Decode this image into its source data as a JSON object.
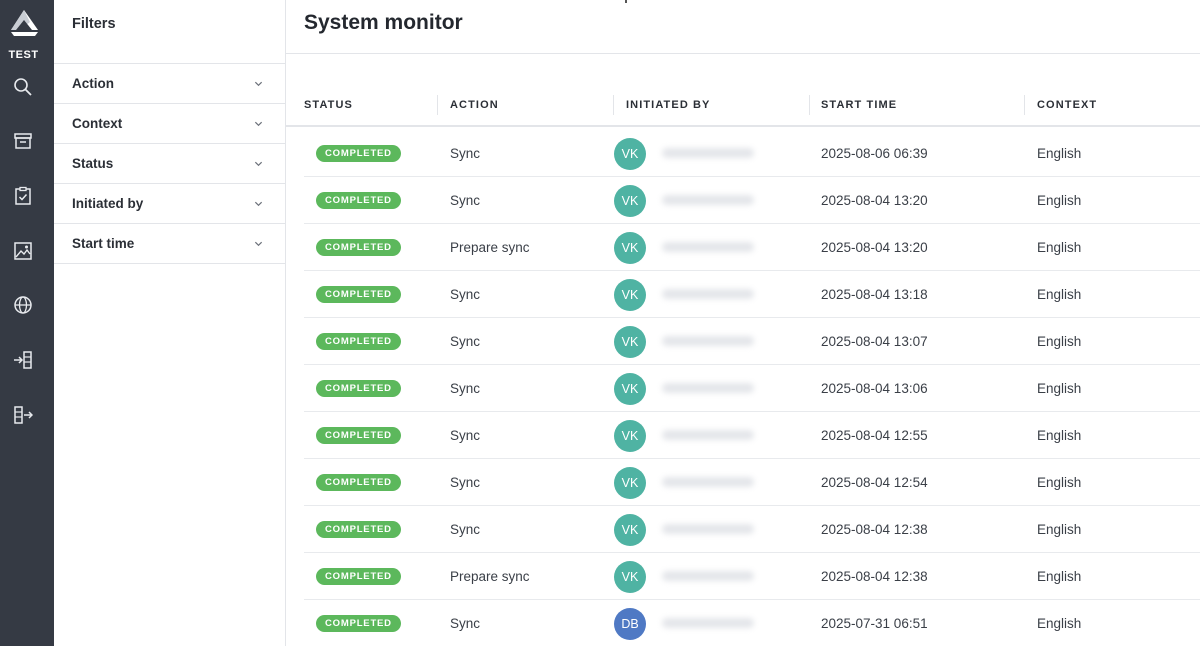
{
  "app": {
    "logo_text": "TEST"
  },
  "rail": {
    "icons": [
      "search-icon",
      "archive-icon",
      "clipboard-check-icon",
      "image-icon",
      "globe-icon",
      "import-icon",
      "export-icon"
    ]
  },
  "filters": {
    "title": "Filters",
    "items": [
      {
        "label": "Action"
      },
      {
        "label": "Context"
      },
      {
        "label": "Status"
      },
      {
        "label": "Initiated by"
      },
      {
        "label": "Start time"
      }
    ]
  },
  "main": {
    "title": "System monitor",
    "columns": [
      "STATUS",
      "ACTION",
      "INITIATED BY",
      "START TIME",
      "CONTEXT"
    ],
    "rows": [
      {
        "status": "COMPLETED",
        "action": "Sync",
        "initials": "VK",
        "start_time": "2025-08-06 06:39",
        "context": "English"
      },
      {
        "status": "COMPLETED",
        "action": "Sync",
        "initials": "VK",
        "start_time": "2025-08-04 13:20",
        "context": "English"
      },
      {
        "status": "COMPLETED",
        "action": "Prepare sync",
        "initials": "VK",
        "start_time": "2025-08-04 13:20",
        "context": "English"
      },
      {
        "status": "COMPLETED",
        "action": "Sync",
        "initials": "VK",
        "start_time": "2025-08-04 13:18",
        "context": "English"
      },
      {
        "status": "COMPLETED",
        "action": "Sync",
        "initials": "VK",
        "start_time": "2025-08-04 13:07",
        "context": "English"
      },
      {
        "status": "COMPLETED",
        "action": "Sync",
        "initials": "VK",
        "start_time": "2025-08-04 13:06",
        "context": "English"
      },
      {
        "status": "COMPLETED",
        "action": "Sync",
        "initials": "VK",
        "start_time": "2025-08-04 12:55",
        "context": "English"
      },
      {
        "status": "COMPLETED",
        "action": "Sync",
        "initials": "VK",
        "start_time": "2025-08-04 12:54",
        "context": "English"
      },
      {
        "status": "COMPLETED",
        "action": "Sync",
        "initials": "VK",
        "start_time": "2025-08-04 12:38",
        "context": "English"
      },
      {
        "status": "COMPLETED",
        "action": "Prepare sync",
        "initials": "VK",
        "start_time": "2025-08-04 12:38",
        "context": "English"
      },
      {
        "status": "COMPLETED",
        "action": "Sync",
        "initials": "DB",
        "start_time": "2025-07-31 06:51",
        "context": "English"
      }
    ]
  },
  "colors": {
    "rail_bg": "#353a44",
    "status_completed": "#5cb85c",
    "avatar_vk": "#4fb3a3",
    "avatar_db": "#4f79c4"
  }
}
